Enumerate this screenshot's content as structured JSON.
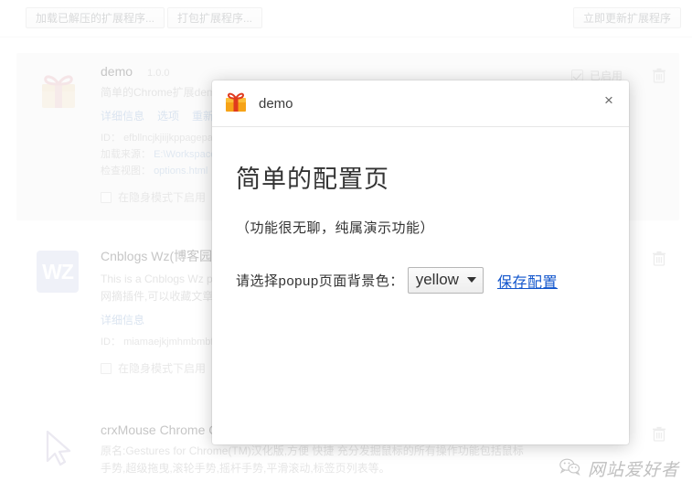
{
  "toolbar": {
    "load_unpacked_label": "加载已解压的扩展程序...",
    "pack_label": "打包扩展程序...",
    "update_now_label": "立即更新扩展程序"
  },
  "extensions": [
    {
      "icon": "gift-icon",
      "name": "demo",
      "version": "1.0.0",
      "description": "简单的Chrome扩展demo",
      "links": [
        "详细信息",
        "选项",
        "重新加"
      ],
      "meta": [
        {
          "label": "ID：",
          "value": "efbllncjkjiijkppagepa"
        },
        {
          "label": "加载来源：",
          "value": "E:\\Workspace"
        },
        {
          "label": "检查视图：",
          "value": "options.html"
        }
      ],
      "incognito_label": "在隐身模式下启用",
      "enabled_label": "已启用",
      "enabled": true,
      "delete_icon": "trash-icon"
    },
    {
      "icon": "wz-icon",
      "icon_text": "WZ",
      "name": "Cnblogs Wz(博客园网",
      "version": "",
      "description": "This is a Cnblogs Wz plu",
      "description2": "网摘插件,可以收藏文章至",
      "links": [
        "详细信息"
      ],
      "meta": [
        {
          "label": "ID：",
          "value": "miamaejkjmhmbmbf"
        }
      ],
      "incognito_label": "在隐身模式下启用",
      "enabled_label": "",
      "enabled": false,
      "delete_icon": "trash-icon"
    },
    {
      "icon": "cursor-icon",
      "name": "crxMouse Chrome Ge",
      "version": "",
      "description": "原名:Gestures for Chrome(TM)汉化版,方便 快捷 充分发掘鼠标的所有操作功能包括鼠标",
      "description2": "手势,超级拖曳,滚轮手势,摇杆手势,平滑滚动,标签页列表等。",
      "links": [],
      "meta": [],
      "incognito_label": "",
      "enabled_label": "",
      "enabled": false,
      "delete_icon": "trash-icon"
    }
  ],
  "modal": {
    "icon": "gift-icon",
    "title": "demo",
    "close_label": "×",
    "heading": "简单的配置页",
    "subtitle": "（功能很无聊，纯属演示功能）",
    "select_label": "请选择popup页面背景色：",
    "select_value": "yellow",
    "select_options": [
      "yellow"
    ],
    "save_link_label": "保存配置",
    "link_color": "#1155cc"
  },
  "watermark": {
    "icon": "wechat-icon",
    "text": "网站爱好者"
  }
}
